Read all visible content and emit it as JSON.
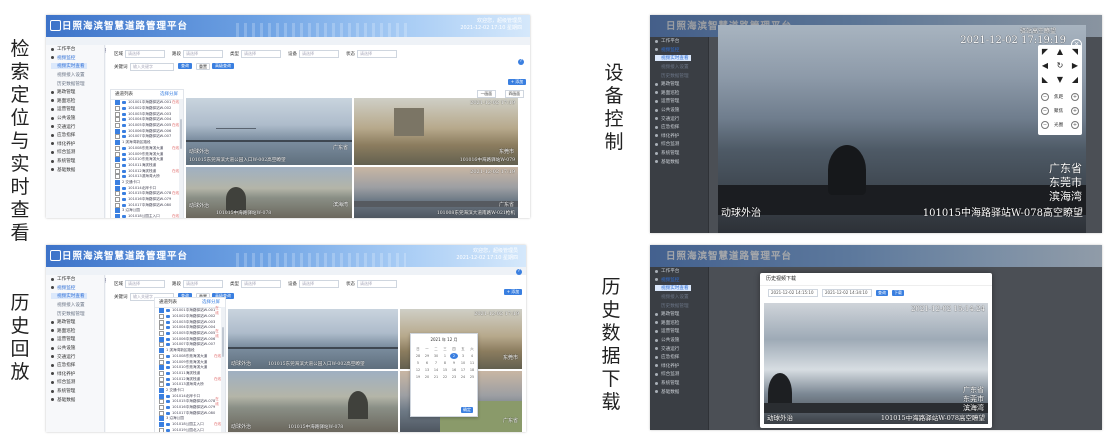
{
  "labels": {
    "search": "检索定位与实时查看",
    "device": "设备控制",
    "playback": "历史回放",
    "download": "历史数据下载"
  },
  "app": {
    "title": "日照海滨智慧道路管理平台",
    "user_info": "欢迎您，超级管理员",
    "datetime": "2021-12-02 17:10 星期四",
    "breadcrumb": "视频监控 / 视频实时查看"
  },
  "sidebar": {
    "items": [
      {
        "label": "工作平台"
      },
      {
        "label": "视频监控",
        "active": true
      },
      {
        "label": "视频实时查看",
        "sub": true,
        "on": true
      },
      {
        "label": "视频接入设置",
        "sub": true
      },
      {
        "label": "历史数据管理",
        "sub": true
      },
      {
        "label": "路政管理"
      },
      {
        "label": "路面巡检"
      },
      {
        "label": "运营管理"
      },
      {
        "label": "公共设施"
      },
      {
        "label": "交通运行"
      },
      {
        "label": "应急指挥"
      },
      {
        "label": "绿化养护"
      },
      {
        "label": "综合监测"
      },
      {
        "label": "系统管理"
      },
      {
        "label": "基础数据"
      }
    ]
  },
  "filter": {
    "fields": [
      "区域",
      "路段",
      "类型",
      "设备",
      "状态"
    ],
    "placeholder": "请选择",
    "name_label": "关键词",
    "name_placeholder": "输入关键字",
    "query": "查询",
    "reset": "重置",
    "advanced": "高级查询",
    "add": "+ 添加"
  },
  "tree": {
    "title": "通道列表",
    "select": "选择分屏",
    "items": [
      "101001中海路驿站W-001",
      "101002中海路驿站W-002",
      "101003中海路驿站W-003",
      "101004中海路驿站W-004",
      "101005中海路驿站W-005",
      "101006中海路驿站W-006",
      "101007中海路驿站W-007",
      "1 滨海湾新区路段",
      "101008东莞海滨大道",
      "101009东莞海滨大道",
      "101010东莞海滨大道",
      "101011海滨栈道",
      "101012海滨栈道",
      "101013滨海湾大桥",
      "2 交通卡口",
      "101014北岸卡口",
      "101015中海路驿站W-078",
      "101016中海路驿站W-079",
      "101017中海路驿站W-080",
      "3 沿海公园",
      "101018公园主入口",
      "101019公园北入口",
      "101020海滨广场",
      "101021海滨广场东",
      "101022停车场",
      "101023停车场出口"
    ],
    "live": "在线"
  },
  "videos": {
    "view_label": "一画面",
    "layout_label": "四画面",
    "top_left_caption": "101015东莞海滨大道公园入口W-002高空瞭望",
    "top_left_loc": "动球外治",
    "top_right_caption": "101016中海路驿站W-079",
    "bottom_left_caption": "101015中海路驿站W-078",
    "bottom_left_loc": "动球外治",
    "bottom_right_caption": "101008东莞海滨大道南路W-021枪机",
    "timestamp_tr": "2021-12-02 17:19",
    "timestamp_br": "2021-12-02 17:19",
    "timestamp_main": "2021-12-02 17:19:19",
    "province": "广东省",
    "city": "东莞市",
    "bay": "滨海湾"
  },
  "device": {
    "window_title": "驿站高空瞭望",
    "caption": "101015中海路驿站W-078高空瞭望",
    "loc": "动球外治",
    "zoom_labels": [
      "焦距",
      "聚焦",
      "光圈"
    ]
  },
  "calendar": {
    "header": "2021 年 12 月",
    "weekdays": [
      "日",
      "一",
      "二",
      "三",
      "四",
      "五",
      "六"
    ],
    "days": [
      "28",
      "29",
      "30",
      "1",
      "2",
      "3",
      "4",
      "5",
      "6",
      "7",
      "8",
      "9",
      "10",
      "11",
      "12",
      "13",
      "14",
      "15",
      "16",
      "17",
      "18",
      "19",
      "20",
      "21",
      "22",
      "23",
      "24",
      "25"
    ],
    "selected": "2",
    "confirm": "确定"
  },
  "download": {
    "title": "历史视频下载",
    "start": "2021-12-02 14:15:10",
    "end": "2021-12-02 14:34:10",
    "query": "查询",
    "download": "下载",
    "timestamp": "2021-12-02 15:14:24",
    "caption": "101015中海路驿站W-078高空瞭望",
    "loc": "动球外治"
  }
}
